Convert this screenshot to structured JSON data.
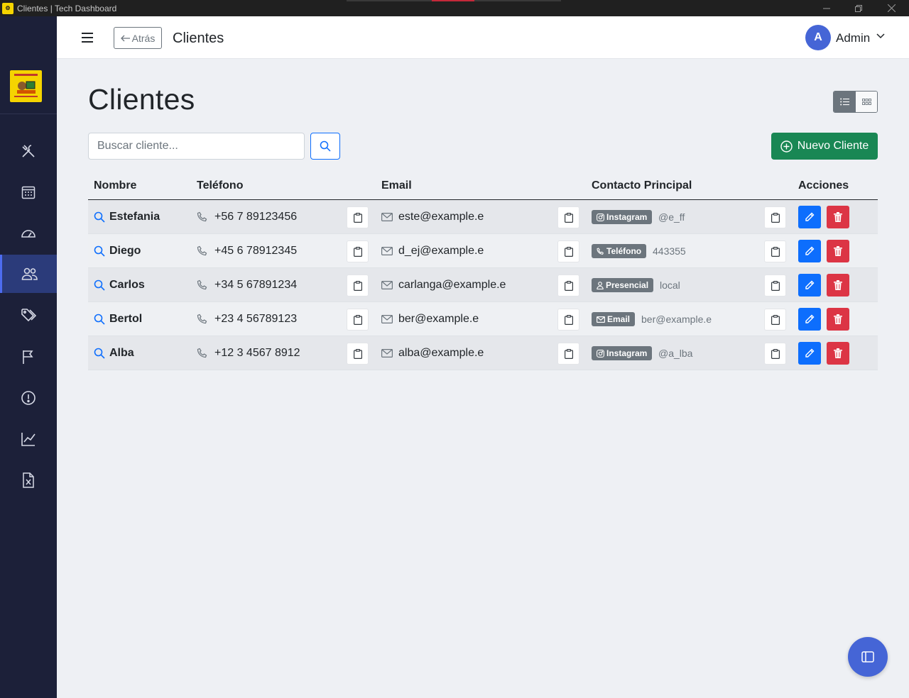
{
  "window": {
    "title": "Clientes | Tech Dashboard"
  },
  "header": {
    "back_label": "Atrás",
    "title": "Clientes",
    "avatar_initial": "A",
    "user_name": "Admin"
  },
  "sidebar": {
    "items": [
      {
        "name": "tools-icon"
      },
      {
        "name": "calendar-icon"
      },
      {
        "name": "speedometer-icon"
      },
      {
        "name": "clients-icon",
        "active": true
      },
      {
        "name": "tags-icon"
      },
      {
        "name": "flag-icon"
      },
      {
        "name": "alert-icon"
      },
      {
        "name": "chart-icon"
      },
      {
        "name": "excel-icon"
      }
    ]
  },
  "main": {
    "title": "Clientes",
    "search_placeholder": "Buscar cliente...",
    "new_button": "Nuevo Cliente",
    "columns": [
      "Nombre",
      "Teléfono",
      "Email",
      "Contacto Principal",
      "Acciones"
    ],
    "rows": [
      {
        "name": "Estefania",
        "phone": "+56 7 89123456",
        "email": "este@example.e",
        "contact_type": "Instagram",
        "contact_icon": "instagram",
        "contact_value": "@e_ff"
      },
      {
        "name": "Diego",
        "phone": "+45 6 78912345",
        "email": "d_ej@example.e",
        "contact_type": "Teléfono",
        "contact_icon": "phone",
        "contact_value": "443355"
      },
      {
        "name": "Carlos",
        "phone": "+34 5 67891234",
        "email": "carlanga@example.e",
        "contact_type": "Presencial",
        "contact_icon": "person",
        "contact_value": "local"
      },
      {
        "name": "Bertol",
        "phone": "+23 4 56789123",
        "email": "ber@example.e",
        "contact_type": "Email",
        "contact_icon": "email",
        "contact_value": "ber@example.e"
      },
      {
        "name": "Alba",
        "phone": "+12 3 4567 8912",
        "email": "alba@example.e",
        "contact_type": "Instagram",
        "contact_icon": "instagram",
        "contact_value": "@a_lba"
      }
    ]
  },
  "colors": {
    "sidebar": "#1c2039",
    "primary": "#0d6efd",
    "success": "#198754",
    "danger": "#dc3545",
    "accent": "#4565d6"
  }
}
